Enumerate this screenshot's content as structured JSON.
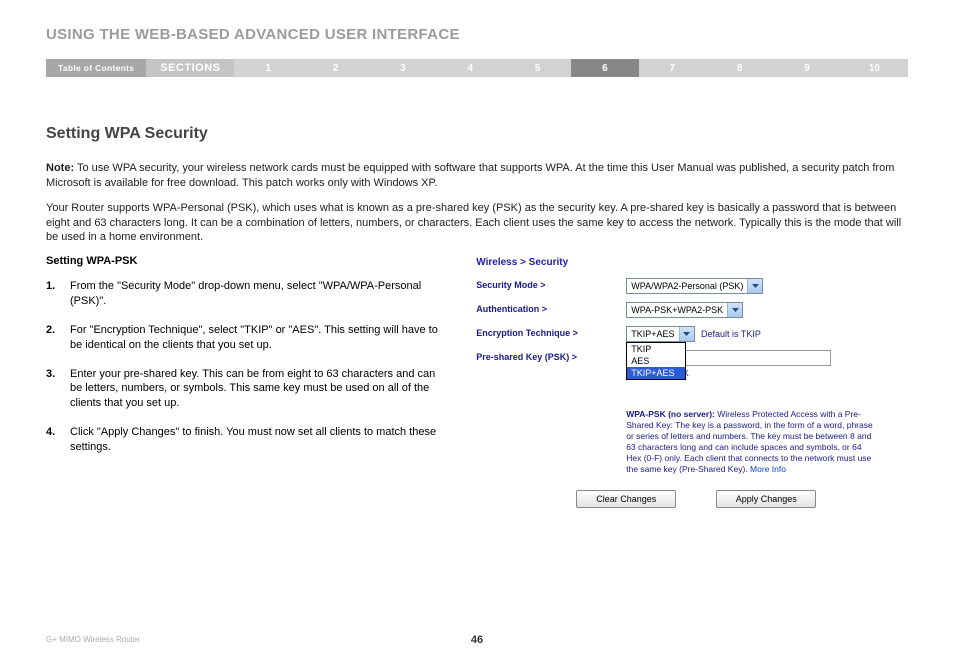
{
  "header": {
    "chapter_title": "USING THE WEB-BASED ADVANCED USER INTERFACE",
    "toc_label": "Table of Contents",
    "sections_label": "SECTIONS",
    "section_numbers": [
      "1",
      "2",
      "3",
      "4",
      "5",
      "6",
      "7",
      "8",
      "9",
      "10"
    ],
    "active_index": 5
  },
  "main": {
    "heading": "Setting WPA Security",
    "note_label": "Note:",
    "note_text": " To use WPA security, your wireless network cards must be equipped with software that supports WPA. At the time this User Manual was published, a security patch from Microsoft is available for free download. This patch works only with Windows XP.",
    "para2": "Your Router supports WPA-Personal (PSK), which uses what is known as a pre-shared key (PSK) as the security key. A pre-shared key is basically a password that is between eight and 63 characters long. It can be a combination of letters, numbers, or characters. Each client uses the same key to access the network. Typically this is the mode that will be used in a home environment.",
    "sub_heading": "Setting WPA-PSK",
    "steps": [
      "From the \"Security Mode\" drop-down menu, select \"WPA/WPA-Personal (PSK)\".",
      "For \"Encryption Technique\", select \"TKIP\" or \"AES\". This setting will have to be identical on the clients that you set up.",
      "Enter your pre-shared key. This can be from eight to 63 characters and can be letters, numbers, or symbols. This same key must be used on all of the clients that you set up.",
      "Click \"Apply Changes\" to finish. You must now set all clients to match these settings."
    ]
  },
  "panel": {
    "breadcrumb": "Wireless > Security",
    "rows": {
      "security_mode": {
        "label": "Security Mode >",
        "value": "WPA/WPA2-Personal (PSK)"
      },
      "authentication": {
        "label": "Authentication >",
        "value": "WPA-PSK+WPA2-PSK"
      },
      "encryption": {
        "label": "Encryption Technique >",
        "value": "TKIP+AES",
        "default_note": "Default is TKIP",
        "options": [
          "TKIP",
          "AES",
          "TKIP+AES"
        ],
        "highlighted": "TKIP+AES"
      },
      "psk": {
        "label": "Pre-shared Key (PSK) >",
        "value": "",
        "obscure_label": "Obscure PSK"
      }
    },
    "help": {
      "title": "WPA-PSK (no server):",
      "body": " Wireless Protected Access with a Pre-Shared Key: The key is a password, in the form of a word, phrase or series of letters and numbers. The key must be between 8 and 63 characters long and can include spaces and symbols, or 64 Hex (0-F) only. Each client that connects to the network must use the same key (Pre-Shared Key). ",
      "more": "More Info"
    },
    "buttons": {
      "clear": "Clear Changes",
      "apply": "Apply Changes"
    }
  },
  "footer": {
    "product": "G+ MIMO Wireless Router",
    "page": "46"
  }
}
